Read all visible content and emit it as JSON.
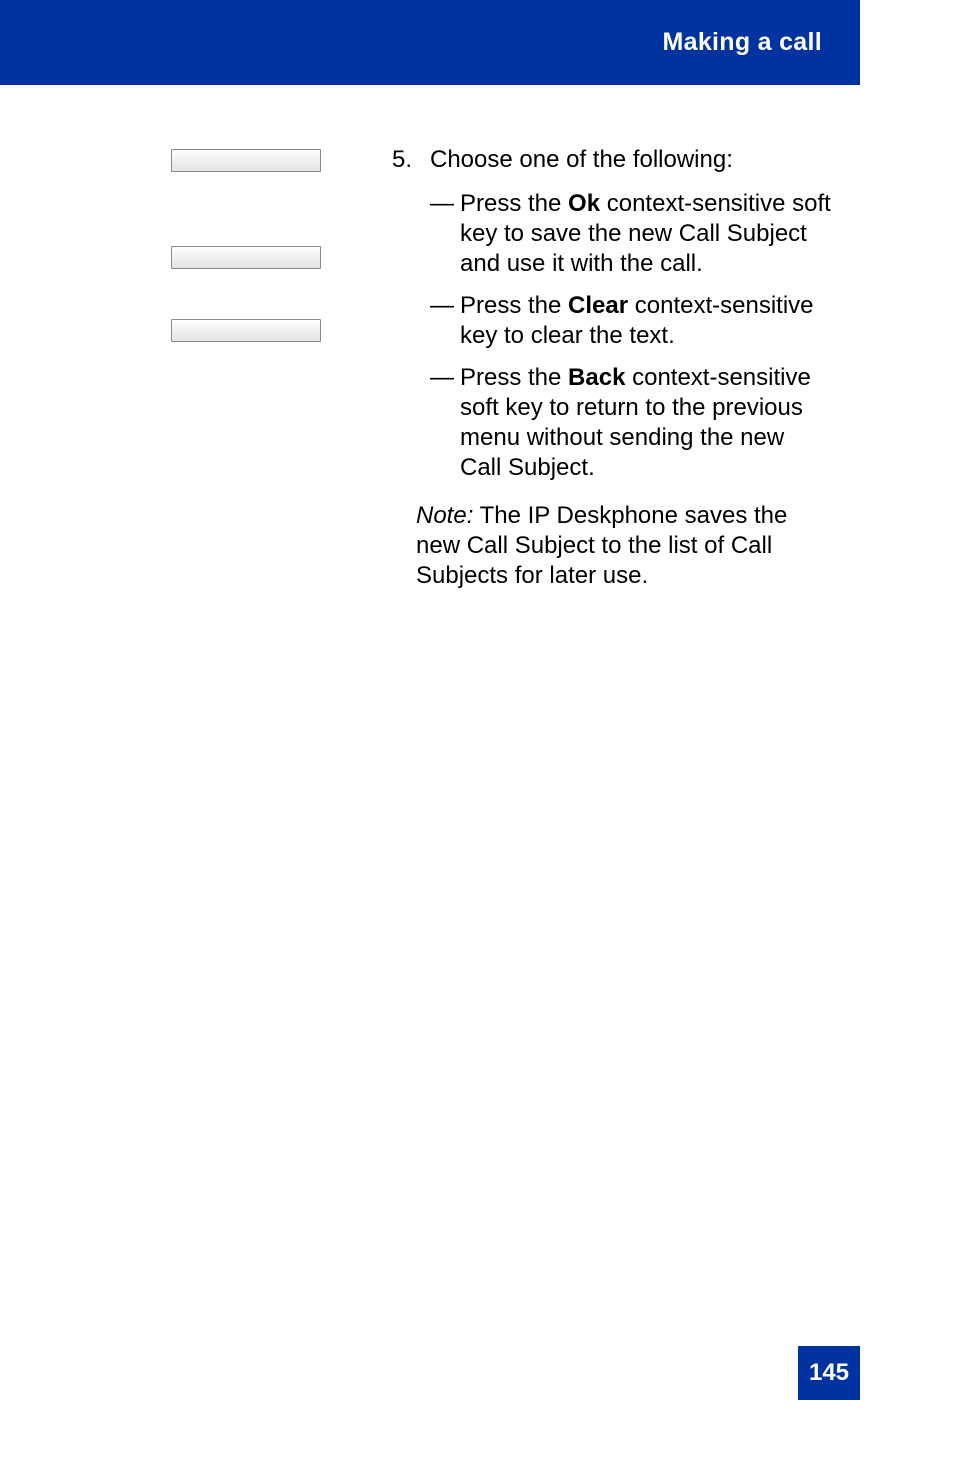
{
  "header": {
    "title": "Making a call"
  },
  "softkeys": {
    "ok": "Ok",
    "clear": "Clear",
    "back": "Back"
  },
  "step": {
    "num": "5.",
    "intro": "Choose one of the following:",
    "dash": "—",
    "items": [
      {
        "pre": "Press the ",
        "key": "Ok",
        "post": " context-sensitive soft key to save the new Call Subject and use it with the call."
      },
      {
        "pre": "Press the ",
        "key": "Clear",
        "post": " context-sensitive key to clear the text."
      },
      {
        "pre": "Press the ",
        "key": "Back",
        "post": " context-sensitive soft key to return to the previous menu without sending the new Call Subject."
      }
    ],
    "note_label": "Note:",
    "note_text": " The IP Deskphone saves the new Call Subject to the list of Call Subjects for later use."
  },
  "page_number": "145"
}
